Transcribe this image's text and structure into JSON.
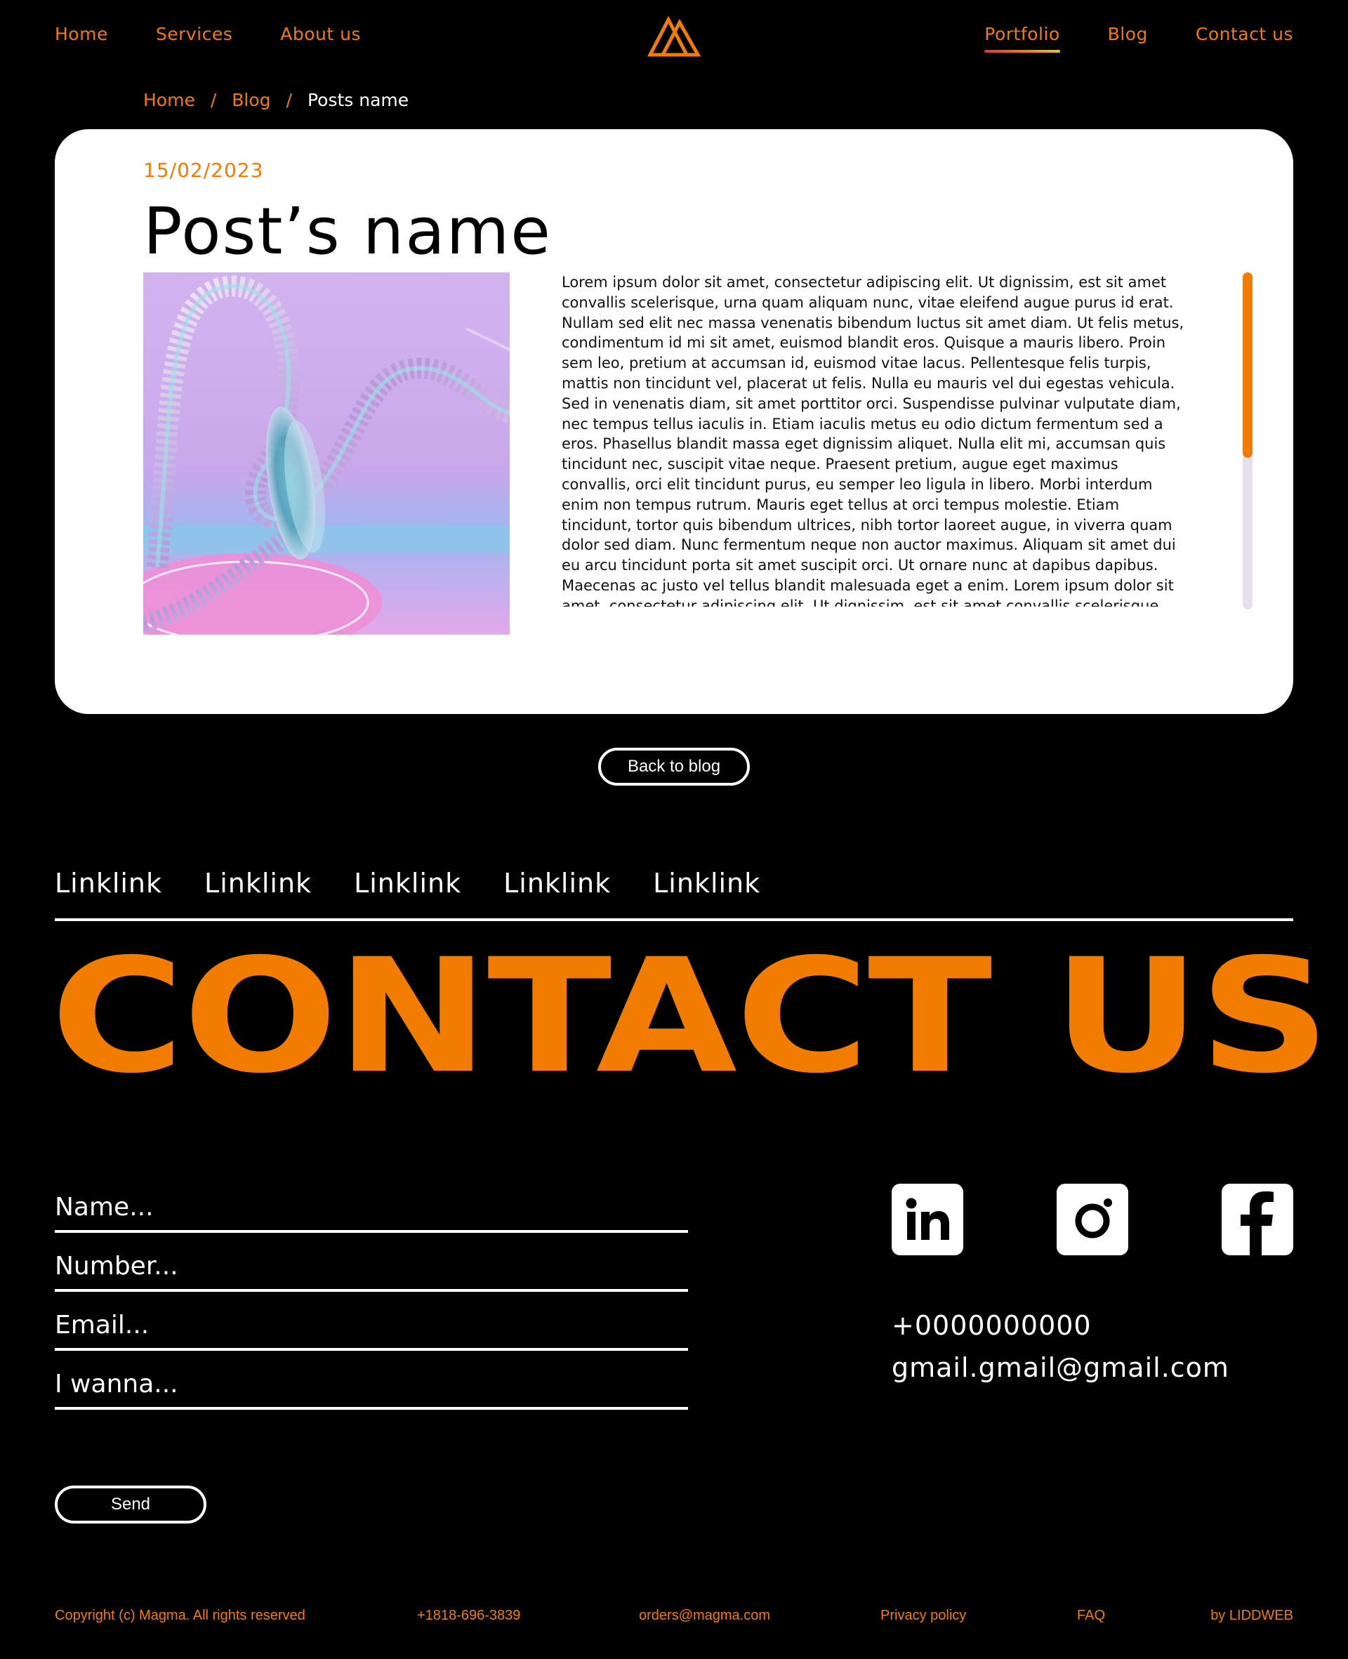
{
  "header": {
    "nav_left": [
      "Home",
      "Services",
      "About us"
    ],
    "nav_right": [
      "Portfolio",
      "Blog",
      "Contact us"
    ],
    "active": "Portfolio",
    "logo_icon": "triangle-logo-icon"
  },
  "breadcrumb": {
    "items": [
      "Home",
      "Blog",
      "Posts name"
    ],
    "separator": "/"
  },
  "post": {
    "date": "15/02/2023",
    "title": "Post’s name",
    "body": "Lorem ipsum dolor sit amet, consectetur adipiscing elit. Ut dignissim, est sit amet convallis scelerisque, urna quam aliquam nunc, vitae eleifend augue purus id erat. Nullam sed elit nec massa venenatis bibendum luctus sit amet diam. Ut felis metus, condimentum id mi sit amet, euismod blandit eros. Quisque a mauris libero. Proin sem leo, pretium at accumsan id, euismod vitae lacus. Pellentesque felis turpis, mattis non tincidunt vel, placerat ut felis. Nulla eu mauris vel dui egestas vehicula. Sed in venenatis diam, sit amet porttitor orci. Suspendisse pulvinar vulputate diam, nec tempus tellus iaculis in. Etiam iaculis metus eu odio dictum fermentum sed a eros. Phasellus blandit massa eget dignissim aliquet. Nulla elit mi, accumsan quis tincidunt nec, suscipit vitae neque. Praesent pretium, augue eget maximus convallis, orci elit tincidunt purus, eu semper leo ligula in libero. Morbi interdum enim non tempus rutrum. Mauris eget tellus at orci tempus molestie. Etiam tincidunt, tortor quis bibendum ultrices, nibh tortor laoreet augue, in viverra quam dolor sed diam. Nunc fermentum neque non auctor maximus. Aliquam sit amet dui eu arcu tincidunt porta sit amet suscipit orci. Ut ornare nunc at dapibus dapibus. Maecenas ac justo vel tellus blandit malesuada eget a enim. Lorem ipsum dolor sit amet, consectetur adipiscing elit. Ut dignissim, est sit amet convallis scelerisque, urna quam aliquam nunc, vitae eleifend augue purus id erat. Nullam sed elit",
    "scroll_position": 0.0
  },
  "back_button": "Back to blog",
  "footer_links": [
    "Linklink",
    "Linklink",
    "Linklink",
    "Linklink",
    "Linklink"
  ],
  "contact": {
    "heading": "CONTACT US",
    "form": {
      "name_placeholder": "Name...",
      "number_placeholder": "Number...",
      "email_placeholder": "Email...",
      "message_placeholder": "I wanna...",
      "send": "Send"
    },
    "social": [
      "linkedin-icon",
      "instagram-icon",
      "facebook-icon"
    ],
    "phone": "+0000000000",
    "email": "gmail.gmail@gmail.com"
  },
  "bottom_bar": {
    "copyright": "Copyright (c) Magma. All rights reserved",
    "phone": "+1818-696-3839",
    "email": "orders@magma.com",
    "privacy": "Privacy policy",
    "faq": "FAQ",
    "credit": "by LIDDWEB"
  },
  "colors": {
    "accent": "#f27c00",
    "background": "#000000",
    "card": "#ffffff",
    "scroll_track": "#e6dfee"
  }
}
